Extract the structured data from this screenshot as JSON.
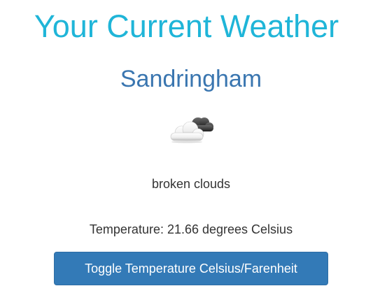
{
  "header": {
    "title": "Your Current Weather"
  },
  "location": {
    "city": "Sandringham"
  },
  "weather": {
    "icon": "broken-clouds-icon",
    "description": "broken clouds",
    "temperature_text": "Temperature: 21.66 degrees Celsius"
  },
  "actions": {
    "toggle_label": "Toggle Temperature Celsius/Farenheit"
  },
  "colors": {
    "title": "#1fb5d8",
    "city": "#3a76b0",
    "button": "#337ab7",
    "text": "#333333"
  }
}
